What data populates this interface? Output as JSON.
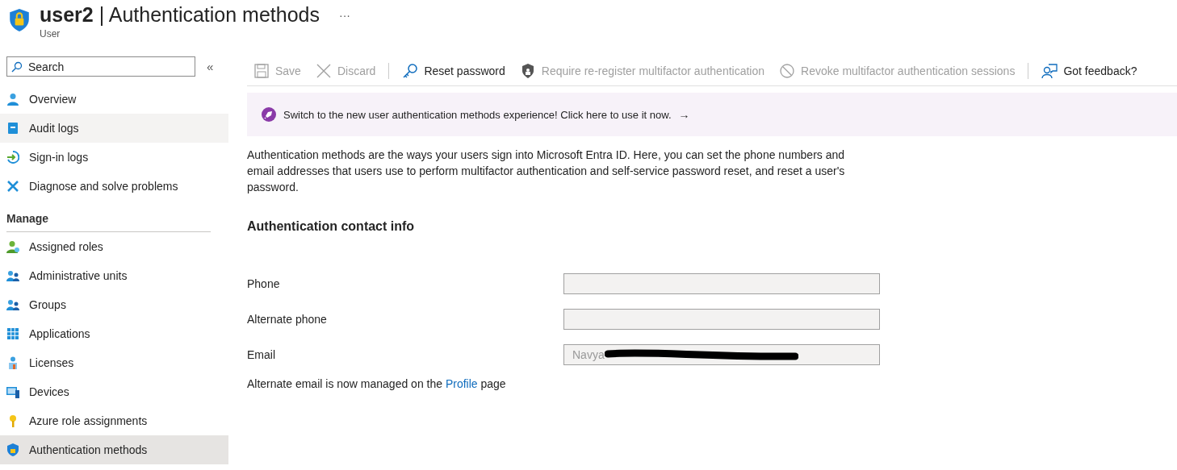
{
  "header": {
    "title_bold": "user2",
    "divider": "|",
    "title_rest": "Authentication methods",
    "subtitle": "User",
    "more": "···"
  },
  "sidebar": {
    "search": {
      "placeholder": "Search"
    },
    "collapse": "«",
    "items": [
      {
        "label": "Overview",
        "selected": false,
        "hovered": false
      },
      {
        "label": "Audit logs",
        "selected": false,
        "hovered": true
      },
      {
        "label": "Sign-in logs",
        "selected": false,
        "hovered": false
      },
      {
        "label": "Diagnose and solve problems",
        "selected": false,
        "hovered": false
      }
    ],
    "section": "Manage",
    "manage_items": [
      {
        "label": "Assigned roles",
        "selected": false,
        "hovered": false
      },
      {
        "label": "Administrative units",
        "selected": false,
        "hovered": false
      },
      {
        "label": "Groups",
        "selected": false,
        "hovered": false
      },
      {
        "label": "Applications",
        "selected": false,
        "hovered": false
      },
      {
        "label": "Licenses",
        "selected": false,
        "hovered": false
      },
      {
        "label": "Devices",
        "selected": false,
        "hovered": false
      },
      {
        "label": "Azure role assignments",
        "selected": false,
        "hovered": false
      },
      {
        "label": "Authentication methods",
        "selected": true,
        "hovered": false
      }
    ]
  },
  "toolbar": [
    {
      "kind": "button",
      "label": "Save",
      "disabled": true
    },
    {
      "kind": "button",
      "label": "Discard",
      "disabled": true
    },
    {
      "kind": "separator"
    },
    {
      "kind": "button",
      "label": "Reset password",
      "disabled": false
    },
    {
      "kind": "button",
      "label": "Require re-register multifactor authentication",
      "disabled": true
    },
    {
      "kind": "button",
      "label": "Revoke multifactor authentication sessions",
      "disabled": true
    },
    {
      "kind": "separator"
    },
    {
      "kind": "button",
      "label": "Got feedback?",
      "disabled": false
    }
  ],
  "banner": {
    "text": "Switch to the new user authentication methods experience! Click here to use it now.",
    "arrow": "→"
  },
  "description": "Authentication methods are the ways your users sign into Microsoft Entra ID. Here, you can set the phone numbers and email addresses that users use to perform multifactor authentication and self-service password reset, and reset a user's password.",
  "section_title": "Authentication contact info",
  "fields": [
    {
      "label": "Phone",
      "redacted": false
    },
    {
      "label": "Alternate phone",
      "redacted": false
    },
    {
      "label": "Email",
      "value": "Navya",
      "redacted": true
    }
  ],
  "note": {
    "before": "Alternate email is now managed on the ",
    "link": "Profile",
    "after": " page"
  }
}
